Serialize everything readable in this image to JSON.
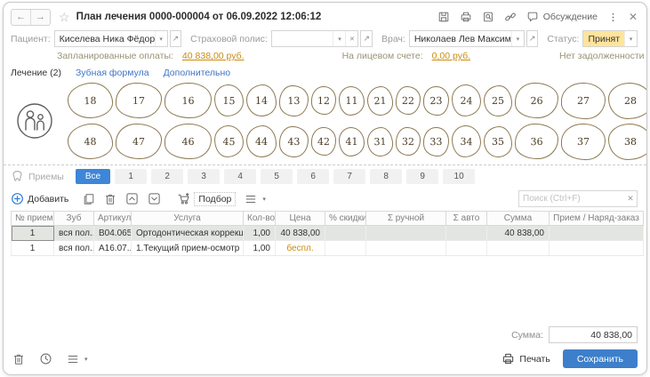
{
  "window": {
    "title": "План лечения 0000-000004 от 06.09.2022 12:06:12"
  },
  "titlebar": {
    "discussion_label": "Обсуждение"
  },
  "patient_row": {
    "patient_label": "Пациент:",
    "patient_value": "Киселева Ника Фёдоровна",
    "policy_label": "Страховой полис:",
    "policy_value": "",
    "doctor_label": "Врач:",
    "doctor_value": "Николаев Лев Максимович",
    "status_label": "Статус:",
    "status_value": "Принят"
  },
  "finance_row": {
    "planned_label": "Запланированные оплаты:",
    "planned_value": "40 838,00  руб.",
    "account_label": "На лицевом счете:",
    "account_value": "0,00  руб.",
    "debt_text": "Нет задолженности"
  },
  "tabs": [
    {
      "label": "Лечение (2)",
      "active": true
    },
    {
      "label": "Зубная формула",
      "active": false
    },
    {
      "label": "Дополнительно",
      "active": false
    }
  ],
  "teeth": {
    "upper": [
      18,
      17,
      16,
      15,
      14,
      13,
      12,
      11,
      21,
      22,
      23,
      24,
      25,
      26,
      27,
      28
    ],
    "lower": [
      48,
      47,
      46,
      45,
      44,
      43,
      42,
      41,
      31,
      32,
      33,
      34,
      35,
      36,
      37,
      38
    ]
  },
  "filter": {
    "label": "Приемы",
    "chips": [
      "Все",
      "1",
      "2",
      "3",
      "4",
      "5",
      "6",
      "7",
      "8",
      "9",
      "10"
    ],
    "active_chip": "Все"
  },
  "toolbar": {
    "add_label": "Добавить",
    "pick_label": "Подбор",
    "search_placeholder": "Поиск (Ctrl+F)"
  },
  "table": {
    "columns": [
      "№ приема",
      "Зуб",
      "Артикул",
      "Услуга",
      "Кол-во",
      "Цена",
      "% скидки",
      "Σ ручной",
      "Σ авто",
      "Сумма",
      "Прием / Наряд-заказ"
    ],
    "rows": [
      {
        "selected": true,
        "cells": [
          "1",
          "вся пол...",
          "В04.065...",
          "Ортодонтическая коррекция н...",
          "1,00",
          "40 838,00",
          "",
          "",
          "",
          "40 838,00",
          ""
        ]
      },
      {
        "selected": false,
        "cells": [
          "1",
          "вся пол...",
          "А16.07....",
          "1.Текущий прием-осмотр",
          "1,00",
          "беспл.",
          "",
          "",
          "",
          "",
          ""
        ]
      }
    ]
  },
  "footer": {
    "sum_label": "Сумма:",
    "sum_value": "40 838,00",
    "print_label": "Печать",
    "save_label": "Сохранить"
  },
  "colors": {
    "accent_blue": "#3d86d8",
    "status_bg": "#ffe49c",
    "link_orange": "#c98c12"
  }
}
